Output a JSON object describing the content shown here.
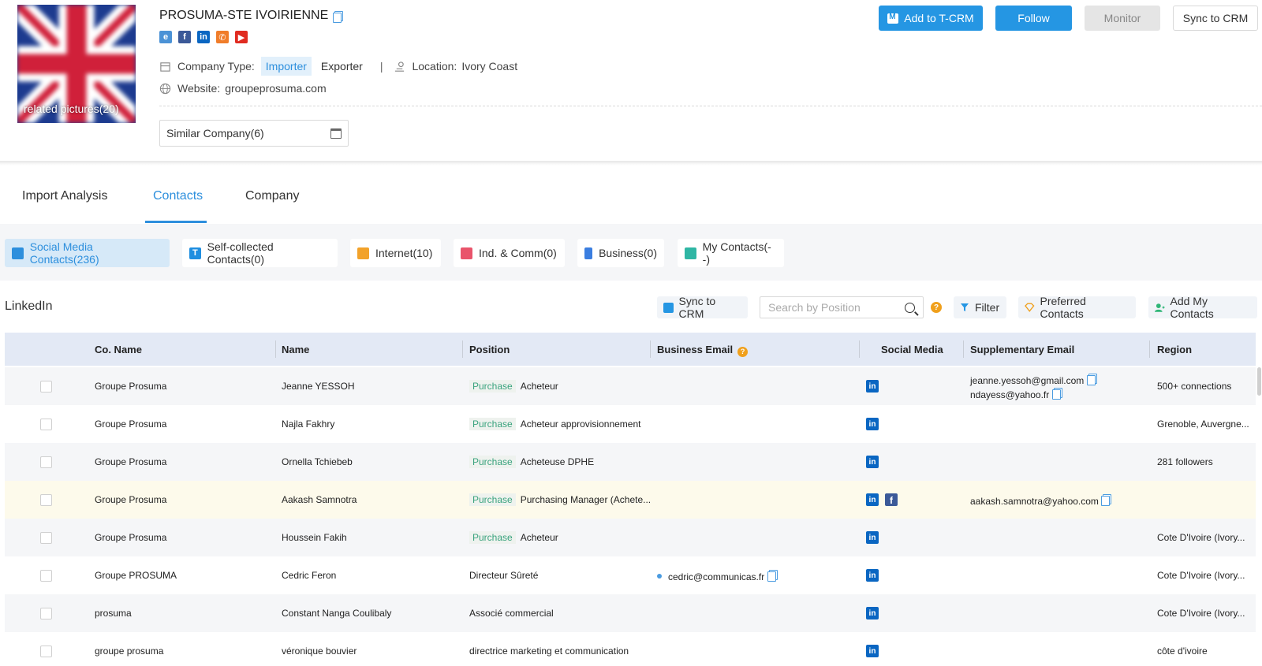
{
  "company": {
    "name": "PROSUMA-STE IVOIRIENNE",
    "logo_caption": "related pictures(20)",
    "company_type_label": "Company Type:",
    "type_importer": "Importer",
    "type_exporter": "Exporter",
    "location_label": "Location:",
    "location_value": "Ivory Coast",
    "website_label": "Website:",
    "website_value": "groupeprosuma.com",
    "similar": "Similar Company(6)"
  },
  "header_buttons": {
    "add_tcrm": "Add to T-CRM",
    "follow": "Follow",
    "monitor": "Monitor",
    "sync": "Sync to CRM"
  },
  "tabs": [
    "Import Analysis",
    "Contacts",
    "Company"
  ],
  "subtabs": [
    "Social Media Contacts(236)",
    "Self-collected Contacts(0)",
    "Internet(10)",
    "Ind. & Comm(0)",
    "Business(0)",
    "My Contacts(--)"
  ],
  "toolbar": {
    "section_title": "LinkedIn",
    "sync": "Sync to CRM",
    "search_placeholder": "Search by Position",
    "filter": "Filter",
    "preferred": "Preferred Contacts",
    "add_my": "Add My Contacts"
  },
  "table": {
    "headers": [
      "Co. Name",
      "Name",
      "Position",
      "Business Email",
      "Social Media",
      "Supplementary Email",
      "Region"
    ],
    "rows": [
      {
        "company": "Groupe Prosuma",
        "name": "Jeanne YESSOH",
        "tag": "Purchase",
        "position": "Acheteur",
        "business_email": "",
        "supp_email_1": "jeanne.yessoh@gmail.com",
        "supp_email_2": "ndayess@yahoo.fr",
        "region": "500+ connections"
      },
      {
        "company": "Groupe Prosuma",
        "name": "Najla Fakhry",
        "tag": "Purchase",
        "position": "Acheteur approvisionnement",
        "business_email": "",
        "supp_email_1": "",
        "supp_email_2": "",
        "region": "Grenoble, Auvergne..."
      },
      {
        "company": "Groupe Prosuma",
        "name": "Ornella Tchiebeb",
        "tag": "Purchase",
        "position": "Acheteuse DPHE",
        "business_email": "",
        "supp_email_1": "",
        "supp_email_2": "",
        "region": "281 followers"
      },
      {
        "company": "Groupe Prosuma",
        "name": "Aakash Samnotra",
        "tag": "Purchase",
        "position": "Purchasing Manager (Achete...",
        "business_email": "",
        "supp_email_1": "aakash.samnotra@yahoo.com",
        "supp_email_2": "",
        "region": ""
      },
      {
        "company": "Groupe Prosuma",
        "name": "Houssein Fakih",
        "tag": "Purchase",
        "position": "Acheteur",
        "business_email": "",
        "supp_email_1": "",
        "supp_email_2": "",
        "region": "Cote D'Ivoire (Ivory..."
      },
      {
        "company": "Groupe PROSUMA",
        "name": "Cedric Feron",
        "tag": "",
        "position": "Directeur Sûreté",
        "business_email": "cedric@communicas.fr",
        "supp_email_1": "",
        "supp_email_2": "",
        "region": "Cote D'Ivoire (Ivory..."
      },
      {
        "company": "prosuma",
        "name": "Constant Nanga Coulibaly",
        "tag": "",
        "position": "Associé commercial",
        "business_email": "",
        "supp_email_1": "",
        "supp_email_2": "",
        "region": "Cote D'Ivoire (Ivory..."
      },
      {
        "company": "groupe prosuma",
        "name": "véronique bouvier",
        "tag": "",
        "position": "directrice marketing et communication",
        "business_email": "",
        "supp_email_1": "",
        "supp_email_2": "",
        "region": "côte d'ivoire"
      }
    ]
  },
  "colors": {
    "accent": "#2596e3",
    "active_tab_bg": "#d6e9f8",
    "table_header_bg": "#e3e9f5",
    "highlight_row": "#fdfaeb",
    "purchase_tag": "#3aa37e"
  }
}
